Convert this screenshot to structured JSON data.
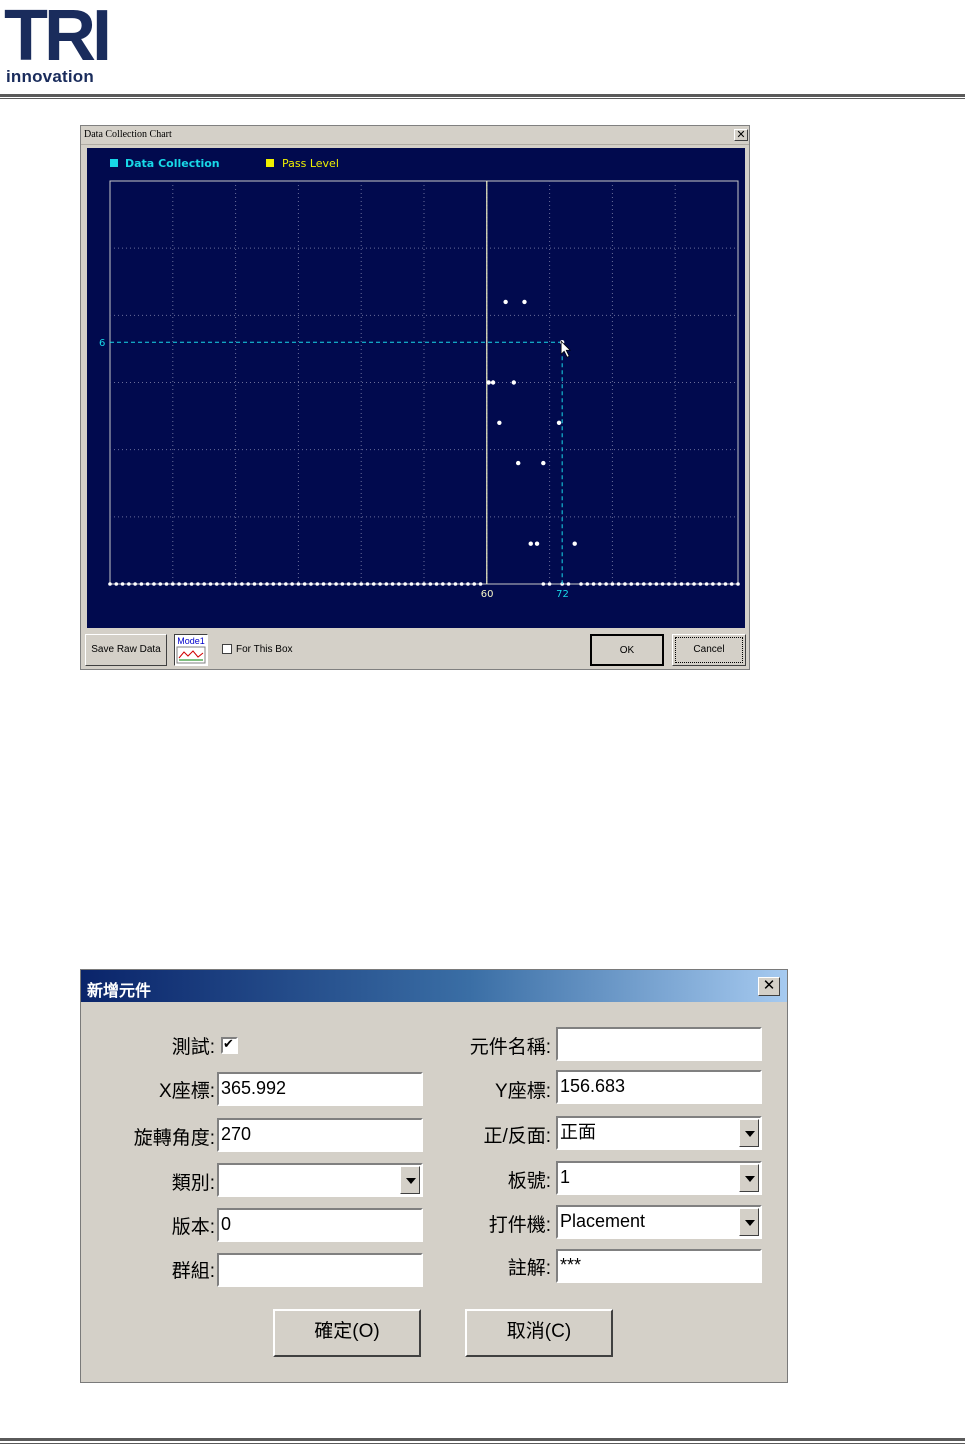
{
  "header": {
    "logo_main": "TRI",
    "logo_sub": "innovation"
  },
  "chart_dialog": {
    "title": "Data Collection Chart",
    "close_glyph": "✕",
    "legend": [
      {
        "label": "Data Collection",
        "color": "#18d8e8"
      },
      {
        "label": "Pass Level",
        "color": "#f0f000"
      }
    ],
    "buttons": {
      "save_raw": "Save Raw Data",
      "mode_label": "Mode1",
      "checkbox_label": "For This Box",
      "ok": "OK",
      "cancel": "Cancel"
    },
    "chart_data": {
      "type": "scatter",
      "x_tick_labels": [
        "60",
        "72"
      ],
      "y_tick_labels": [
        "6"
      ],
      "xlim": [
        0,
        100
      ],
      "ylim": [
        0,
        10
      ],
      "grid": true,
      "pass_level_x": 60,
      "cursor_crosshair": {
        "x": 72,
        "y": 6
      },
      "colors": {
        "background": "#010a4e",
        "points": "#ffffff",
        "crosshair": "#18d8e8",
        "pass_level": "#f8f8c8"
      },
      "points": [
        {
          "x": 63,
          "y": 7
        },
        {
          "x": 66,
          "y": 7
        },
        {
          "x": 72,
          "y": 6
        },
        {
          "x": 60.3,
          "y": 5
        },
        {
          "x": 61,
          "y": 5
        },
        {
          "x": 64.3,
          "y": 5
        },
        {
          "x": 62,
          "y": 4
        },
        {
          "x": 71.5,
          "y": 4
        },
        {
          "x": 65,
          "y": 3
        },
        {
          "x": 69,
          "y": 3
        },
        {
          "x": 67,
          "y": 1
        },
        {
          "x": 68,
          "y": 1
        },
        {
          "x": 74,
          "y": 1
        }
      ],
      "baseline_zero_x_ranges": [
        [
          0,
          59
        ],
        [
          69,
          70
        ],
        [
          72,
          73
        ],
        [
          75,
          100
        ]
      ]
    }
  },
  "add_component_dialog": {
    "title": "新增元件",
    "close_glyph": "✕",
    "left_fields": [
      {
        "label": "測試:",
        "type": "checkbox",
        "checked": true,
        "check_glyph": "✔"
      },
      {
        "label": "X座標:",
        "type": "text",
        "value": "365.992"
      },
      {
        "label": "旋轉角度:",
        "type": "text",
        "value": "270"
      },
      {
        "label": "類別:",
        "type": "select",
        "value": ""
      },
      {
        "label": "版本:",
        "type": "text",
        "value": "0"
      },
      {
        "label": "群組:",
        "type": "text",
        "value": ""
      }
    ],
    "right_fields": [
      {
        "label": "元件名稱:",
        "type": "text",
        "value": ""
      },
      {
        "label": "Y座標:",
        "type": "text",
        "value": "156.683"
      },
      {
        "label": "正/反面:",
        "type": "select",
        "value": "正面"
      },
      {
        "label": "板號:",
        "type": "select",
        "value": "1"
      },
      {
        "label": "打件機:",
        "type": "select",
        "value": "Placement"
      },
      {
        "label": "註解:",
        "type": "text",
        "value": "***"
      }
    ],
    "ok_label": "確定(O)",
    "cancel_label": "取消(C)"
  }
}
